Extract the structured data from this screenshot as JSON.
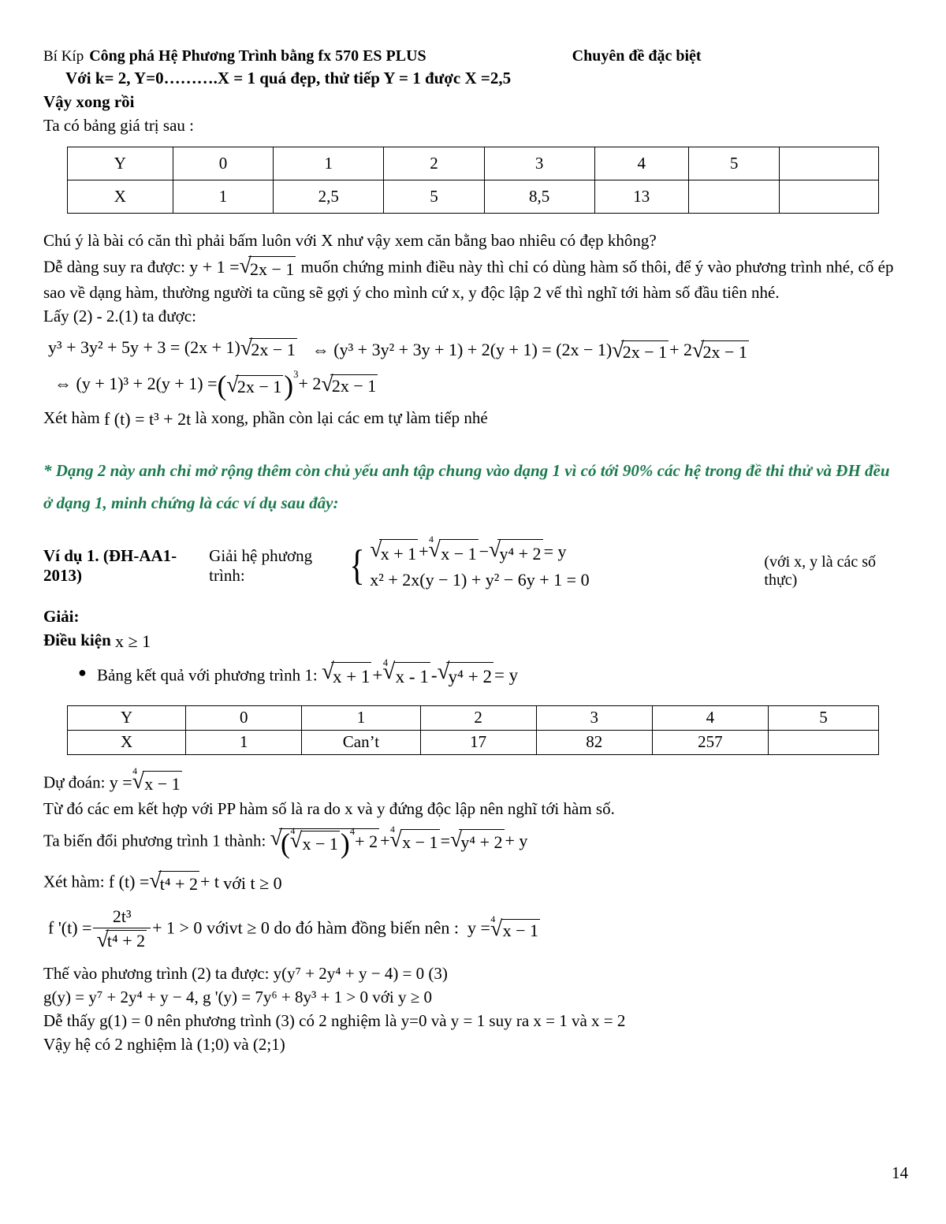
{
  "header": {
    "left_plain": "Bí Kíp",
    "left_bold": "Công phá Hệ Phương Trình bằng fx 570 ES PLUS",
    "right": "Chuyên đề đặc biệt"
  },
  "intro": {
    "line_k": "Với  k= 2, Y=0……….X = 1 quá đẹp, thử tiếp Y = 1 được X =2,5",
    "line_done": "Vậy xong rồi",
    "line_table_intro": "Ta có bảng giá trị sau :"
  },
  "table_1": {
    "rows": [
      [
        "Y",
        "0",
        "1",
        "2",
        "3",
        "4",
        "5",
        ""
      ],
      [
        "X",
        "1",
        "2,5",
        "5",
        "8,5",
        "13",
        "",
        ""
      ]
    ]
  },
  "body": {
    "note_root": "Chú ý là bài có căn thì phải bấm luôn với X như vậy xem căn bằng bao nhiêu có đẹp không?",
    "easy_lead": "Dễ dàng suy ra được:",
    "easy_eq_lhs": "y + 1 =",
    "easy_eq_rad": "2x − 1",
    "easy_tail": "muốn chứng minh điều này thì chỉ có dùng hàm số thôi, để ý vào phương trình nhé, cố ép sao về dạng hàm, thường người ta cũng sẽ gợi ý cho mình cứ x, y độc lập 2 vế thì nghĩ tới hàm số đầu tiên nhé.",
    "take_line": "Lấy (2)  - 2.(1) ta được:",
    "xet_ham_lead": "Xét hàm",
    "xet_ham_tail": "là xong, phần còn lại các em tự làm tiếp nhé"
  },
  "equations": {
    "eq1": {
      "left": "y³ + 3y² + 5y + 3 = (2x + 1)",
      "radicand": "2x − 1"
    },
    "eq2": {
      "left": "⇔ (y³ + 3y² + 3y + 1) + 2(y + 1) = (2x − 1)",
      "radicand_a": "2x − 1",
      "middle": "+ 2",
      "radicand_b": "2x − 1"
    },
    "eq3": {
      "left": "⇔ (y + 1)³ + 2(y + 1) =",
      "radicand_a": "2x − 1",
      "power": "3",
      "middle": "+ 2",
      "radicand_b": "2x − 1"
    },
    "ft": "f (t) = t³ + 2t"
  },
  "green_note": "* Dạng 2 này anh chỉ mở rộng thêm còn chủ yếu anh tập chung vào dạng 1 vì có tới 90% các hệ trong đề thi thử và ĐH đều ở dạng 1, minh chứng là các ví dụ sau đây:",
  "example": {
    "label": "Ví dụ 1. (ĐH-AA1-2013)",
    "prompt": "Giải hệ phương trình:",
    "system": {
      "row1_parts": {
        "rad1": "x + 1",
        "plus": "+",
        "rad2_index": "4",
        "rad2": "x − 1",
        "minus": "−",
        "rad3": "y⁴ + 2",
        "eq": "= y"
      },
      "row2": "x² + 2x(y − 1) + y² − 6y + 1 = 0"
    },
    "note": "(với x, y là các số thực)"
  },
  "solution": {
    "giai": "Giải:",
    "dieu_kien_label": "Điều kiện",
    "dieu_kien_value": "x ≥ 1",
    "bullet_text": "Bảng kết quả với phương trình 1:",
    "bullet_math": {
      "rad1": "x + 1",
      "plus": "+",
      "rad2_index": "4",
      "rad2": "x - 1",
      "minus": "-",
      "rad3": "y⁴ + 2",
      "eq": "= y"
    }
  },
  "table_2": {
    "rows": [
      [
        "Y",
        "0",
        "1",
        "2",
        "3",
        "4",
        "5"
      ],
      [
        "X",
        "1",
        "Can’t",
        "17",
        "82",
        "257",
        ""
      ]
    ]
  },
  "after_table": {
    "du_doan_label": "Dự đoán:",
    "du_doan_eq_lhs": "y =",
    "du_doan_index": "4",
    "du_doan_rad": "x − 1",
    "tu_do": "Từ đó các em  kết hợp với PP hàm số là ra do x và y đứng độc lập nên nghĩ tới hàm số.",
    "bien_doi_label": "Ta biến đổi phương trình 1 thành:",
    "bien_doi": {
      "inner_index": "4",
      "inner_rad": "x − 1",
      "inner_power": "4",
      "plus2": "+ 2",
      "mid_plus": "+",
      "rad2_index": "4",
      "rad2": "x − 1",
      "equals": "=",
      "rad3": "y⁴ + 2",
      "tail": "+ y"
    },
    "xet_ham_label": "Xét hàm:",
    "xet_ham": {
      "lhs": "f (t) =",
      "rad": "t⁴ + 2",
      "tail": "+ t",
      "cond": "với  t ≥ 0"
    },
    "derivative": {
      "lhs": "f '(t) =",
      "num": "2t³",
      "den_rad": "t⁴ + 2",
      "tail": "+ 1 > 0",
      "cond": "vớivt ≥ 0",
      "mid": "do đó hàm đồng biến nên :",
      "result_lhs": "y =",
      "result_index": "4",
      "result_rad": "x − 1"
    },
    "the_vao": "Thế vào phương trình (2) ta được:   y(y⁷ + 2y⁴ + y − 4) = 0  (3)",
    "g_line": "g(y) = y⁷ + 2y⁴ + y − 4, g '(y) = 7y⁶ + 8y³ + 1 > 0  với  y ≥ 0",
    "de_thay": "Dễ thấy  g(1) = 0  nên phương trình (3) có 2 nghiệm là  y=0 và y = 1 suy ra x = 1 và x = 2",
    "vay_he": "Vậy hệ có 2 nghiệm là (1;0) và (2;1)"
  },
  "page_number": "14",
  "colors": {
    "green_accent": "#1B7A4F",
    "text": "#000000"
  }
}
